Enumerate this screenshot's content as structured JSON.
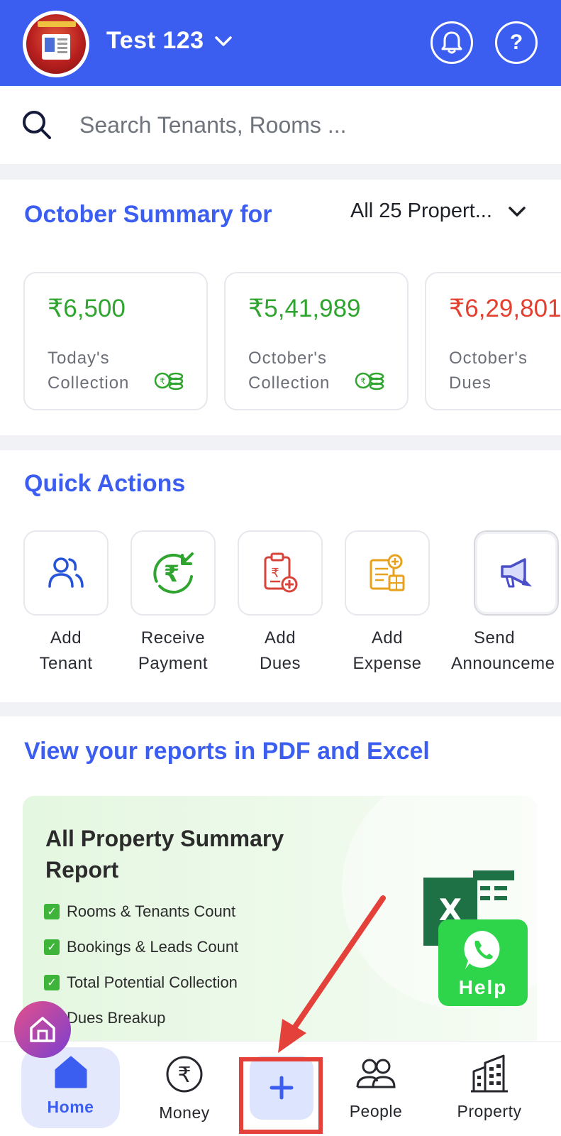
{
  "header": {
    "account_name": "Test 123",
    "help_symbol": "?"
  },
  "search": {
    "placeholder": "Search Tenants, Rooms ..."
  },
  "summary": {
    "title": "October Summary for",
    "property_filter": "All 25 Propert...",
    "cards": [
      {
        "value": "₹6,500",
        "label": "Today's Collection",
        "color": "#2fa52f"
      },
      {
        "value": "₹5,41,989",
        "label": "October's Collection",
        "color": "#2fa52f"
      },
      {
        "value": "₹6,29,801",
        "label": "October's Dues",
        "color": "#e3402f"
      }
    ]
  },
  "quick_actions": {
    "title": "Quick Actions",
    "items": [
      {
        "line1": "Add",
        "line2": "Tenant",
        "icon": "add-tenant-icon"
      },
      {
        "line1": "Receive",
        "line2": "Payment",
        "icon": "receive-payment-icon"
      },
      {
        "line1": "Add",
        "line2": "Dues",
        "icon": "add-dues-icon"
      },
      {
        "line1": "Add",
        "line2": "Expense",
        "icon": "add-expense-icon"
      },
      {
        "line1": "Send",
        "line2": "Announceme",
        "icon": "megaphone-icon"
      }
    ]
  },
  "reports": {
    "title": "View your reports in PDF and Excel",
    "card_heading": "All Property Summary Report",
    "bullets": [
      "Rooms & Tenants Count",
      "Bookings & Leads Count",
      "Total Potential Collection",
      "Dues Breakup"
    ]
  },
  "whatsapp_help": {
    "label": "Help"
  },
  "bottom_nav": {
    "home": "Home",
    "money": "Money",
    "people": "People",
    "property": "Property"
  },
  "colors": {
    "brand": "#3c5ef0",
    "positive": "#2fa52f",
    "negative": "#e3402f",
    "highlight": "#e4413b",
    "whatsapp": "#2ed54a"
  }
}
